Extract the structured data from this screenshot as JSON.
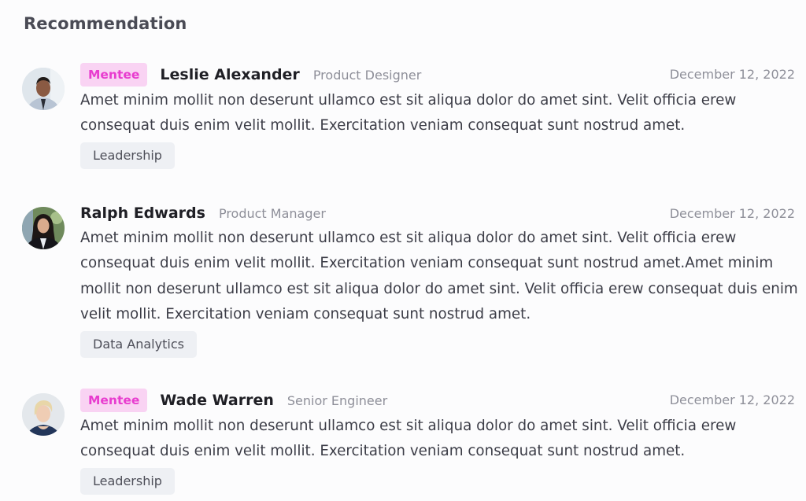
{
  "section": {
    "title": "Recommendation"
  },
  "recommendations": [
    {
      "badge": "Mentee",
      "name": "Leslie Alexander",
      "role": "Product Designer",
      "date": "December 12, 2022",
      "text": "Amet minim mollit non deserunt ullamco est sit aliqua dolor do amet sint. Velit officia erew consequat duis enim velit mollit. Exercitation veniam consequat sunt nostrud amet.",
      "tag": "Leadership",
      "avatar": "avatar-man-shirt-tie"
    },
    {
      "badge": null,
      "name": "Ralph Edwards",
      "role": "Product Manager",
      "date": "December 12, 2022",
      "text": "Amet minim mollit non deserunt ullamco est sit aliqua dolor do amet sint. Velit officia erew consequat duis enim velit mollit. Exercitation veniam consequat sunt nostrud amet.Amet minim mollit non deserunt ullamco est sit aliqua dolor do amet sint. Velit officia erew consequat duis enim velit mollit. Exercitation veniam consequat sunt nostrud amet.",
      "tag": "Data Analytics",
      "avatar": "avatar-woman-dark-hair"
    },
    {
      "badge": "Mentee",
      "name": "Wade Warren",
      "role": "Senior Engineer",
      "date": "December 12, 2022",
      "text": "Amet minim mollit non deserunt ullamco est sit aliqua dolor do amet sint. Velit officia erew consequat duis enim velit mollit. Exercitation veniam consequat sunt nostrud amet.",
      "tag": "Leadership",
      "avatar": "avatar-woman-blonde"
    }
  ],
  "colors": {
    "badge_bg": "#f9d3f3",
    "badge_text": "#e83ccf",
    "tag_bg": "#eef0f4",
    "muted_text": "#8e8f99"
  }
}
